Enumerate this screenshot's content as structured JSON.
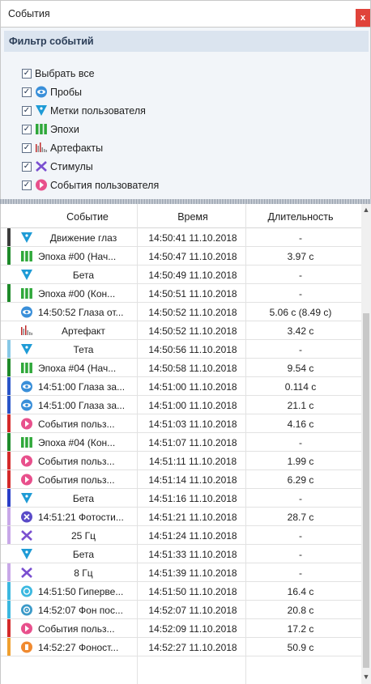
{
  "window": {
    "title": "События",
    "close_label": "x"
  },
  "filter": {
    "header": "Фильтр событий",
    "items": [
      {
        "label": "Выбрать все",
        "icon": "none",
        "color": ""
      },
      {
        "label": "Пробы",
        "icon": "probe-icon",
        "color": "#3a8fd9"
      },
      {
        "label": "Метки пользователя",
        "icon": "user-mark-icon",
        "color": "#1e9bd6"
      },
      {
        "label": "Эпохи",
        "icon": "epoch-icon",
        "color": "#2fa83a"
      },
      {
        "label": "Артефакты",
        "icon": "artifact-icon",
        "color": "#d84a3a"
      },
      {
        "label": "Стимулы",
        "icon": "stimulus-icon",
        "color": "#7a4fd0"
      },
      {
        "label": "События пользователя",
        "icon": "user-event-icon",
        "color": "#e8508c"
      }
    ]
  },
  "table": {
    "columns": [
      "Событие",
      "Время",
      "Длительность"
    ],
    "rows": [
      {
        "name": "Движение глаз",
        "time": "14:50:41 11.10.2018",
        "dur": "-",
        "icon": "user-mark-icon",
        "strip": "#3c3c3c",
        "center": true
      },
      {
        "name": "Эпоха  #00 (Нач...",
        "time": "14:50:47 11.10.2018",
        "dur": "3.97 с",
        "icon": "epoch-icon",
        "strip": "#1e8a2a",
        "center": false
      },
      {
        "name": "Бета",
        "time": "14:50:49 11.10.2018",
        "dur": "-",
        "icon": "user-mark-icon",
        "strip": "#ffffff",
        "center": true
      },
      {
        "name": "Эпоха  #00 (Кон...",
        "time": "14:50:51 11.10.2018",
        "dur": "-",
        "icon": "epoch-icon",
        "strip": "#1e8a2a",
        "center": false
      },
      {
        "name": "14:50:52 Глаза от...",
        "time": "14:50:52 11.10.2018",
        "dur": "5.06 с (8.49 с)",
        "icon": "probe-icon",
        "strip": "#ffffff",
        "center": false
      },
      {
        "name": "Артефакт",
        "time": "14:50:52 11.10.2018",
        "dur": "3.42 с",
        "icon": "artifact-icon",
        "strip": "#ffffff",
        "center": true
      },
      {
        "name": "Тета",
        "time": "14:50:56 11.10.2018",
        "dur": "-",
        "icon": "user-mark-icon",
        "strip": "#87c8e6",
        "center": true
      },
      {
        "name": "Эпоха  #04 (Нач...",
        "time": "14:50:58 11.10.2018",
        "dur": "9.54 с",
        "icon": "epoch-icon",
        "strip": "#1e8a2a",
        "center": false
      },
      {
        "name": "14:51:00 Глаза за...",
        "time": "14:51:00 11.10.2018",
        "dur": "0.114 с",
        "icon": "probe-icon",
        "strip": "#2a55c8",
        "center": false
      },
      {
        "name": "14:51:00 Глаза за...",
        "time": "14:51:00 11.10.2018",
        "dur": "21.1 с",
        "icon": "probe-icon",
        "strip": "#2a55c8",
        "center": false
      },
      {
        "name": "События польз...",
        "time": "14:51:03 11.10.2018",
        "dur": "4.16 с",
        "icon": "user-event-icon",
        "strip": "#d42a2a",
        "center": false
      },
      {
        "name": "Эпоха  #04 (Кон...",
        "time": "14:51:07 11.10.2018",
        "dur": "-",
        "icon": "epoch-icon",
        "strip": "#1e8a2a",
        "center": false
      },
      {
        "name": "События польз...",
        "time": "14:51:11 11.10.2018",
        "dur": "1.99 с",
        "icon": "user-event-icon",
        "strip": "#d42a2a",
        "center": false
      },
      {
        "name": "События польз...",
        "time": "14:51:14 11.10.2018",
        "dur": "6.29 с",
        "icon": "user-event-icon",
        "strip": "#d42a2a",
        "center": false
      },
      {
        "name": "Бета",
        "time": "14:51:16 11.10.2018",
        "dur": "-",
        "icon": "user-mark-icon",
        "strip": "#2a3ec8",
        "center": true
      },
      {
        "name": "14:51:21 Фотости...",
        "time": "14:51:21 11.10.2018",
        "dur": "28.7 с",
        "icon": "photo-stim-icon",
        "strip": "#c8a8e8",
        "center": false
      },
      {
        "name": "25 Гц",
        "time": "14:51:24 11.10.2018",
        "dur": "-",
        "icon": "stimulus-icon",
        "strip": "#c8a8e8",
        "center": true
      },
      {
        "name": "Бета",
        "time": "14:51:33 11.10.2018",
        "dur": "-",
        "icon": "user-mark-icon",
        "strip": "#ffffff",
        "center": true
      },
      {
        "name": "8 Гц",
        "time": "14:51:39 11.10.2018",
        "dur": "-",
        "icon": "stimulus-icon",
        "strip": "#c8a8e8",
        "center": true
      },
      {
        "name": "14:51:50 Гиперве...",
        "time": "14:51:50 11.10.2018",
        "dur": "16.4 с",
        "icon": "hyperventilation-icon",
        "strip": "#3cb8e0",
        "center": false
      },
      {
        "name": "14:52:07 Фон пос...",
        "time": "14:52:07 11.10.2018",
        "dur": "20.8 с",
        "icon": "background-icon",
        "strip": "#3cb8e0",
        "center": false
      },
      {
        "name": "События польз...",
        "time": "14:52:09 11.10.2018",
        "dur": "17.2 с",
        "icon": "user-event-icon",
        "strip": "#d42a2a",
        "center": false
      },
      {
        "name": "14:52:27 Фоност...",
        "time": "14:52:27 11.10.2018",
        "dur": "50.9 с",
        "icon": "phonostim-icon",
        "strip": "#f0a030",
        "center": false
      }
    ]
  },
  "colors": {
    "header_bg": "#dbe4ef",
    "close": "#e0433a",
    "epoch": "#2fa83a",
    "user_mark": "#1e9bd6",
    "user_event": "#e8508c",
    "probe": "#3a8fd9",
    "stimulus": "#7a4fd0",
    "artifact": "#d84a3a"
  }
}
